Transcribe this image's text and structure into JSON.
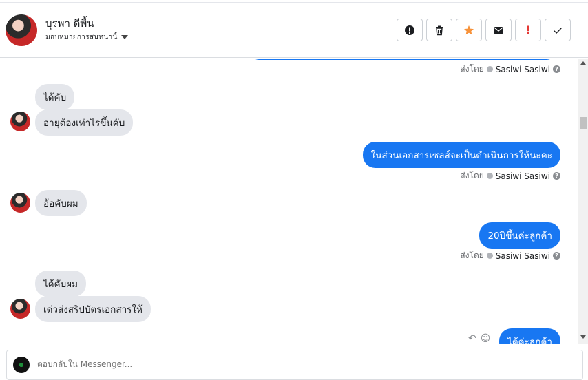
{
  "header": {
    "name": "บุรพา ดีพื้น",
    "assign_label": "มอบหมายการสนทนานี้"
  },
  "toolbar": {
    "actions": [
      {
        "name": "report",
        "icon": "alert-circle-icon"
      },
      {
        "name": "delete",
        "icon": "trash-icon"
      },
      {
        "name": "star",
        "icon": "star-icon",
        "color": "#f7923a"
      },
      {
        "name": "mail",
        "icon": "envelope-icon"
      },
      {
        "name": "important",
        "icon": "exclamation-icon",
        "label": "!",
        "color": "#e53935"
      },
      {
        "name": "done",
        "icon": "check-icon"
      }
    ]
  },
  "thread": {
    "sent_by_label": "ส่งโดย",
    "sender_name": "Sasiwi Sasiwi",
    "messages": [
      {
        "from": "customer",
        "text": "ได้คับ"
      },
      {
        "from": "customer",
        "text": "อายุต้องเท่าไรขึ้นคับ"
      },
      {
        "from": "page",
        "text": "ในส่วนเอกสารเซลส์จะเป็นดำเนินการให้นะคะ"
      },
      {
        "from": "customer",
        "text": "อ้อคับผม"
      },
      {
        "from": "page",
        "text": "20ปีขึ้นค่ะลูกค้า"
      },
      {
        "from": "customer",
        "text": "ได้คับผม"
      },
      {
        "from": "customer",
        "text": "เด่วส่งสริปบัตรเอกสารให้"
      },
      {
        "from": "page",
        "text": "ได้ค่ะลูกค้า"
      }
    ]
  },
  "composer": {
    "placeholder": "ตอบกลับใน Messenger..."
  },
  "colors": {
    "outgoing_bubble": "#1877f2",
    "incoming_bubble": "#e4e6eb"
  }
}
